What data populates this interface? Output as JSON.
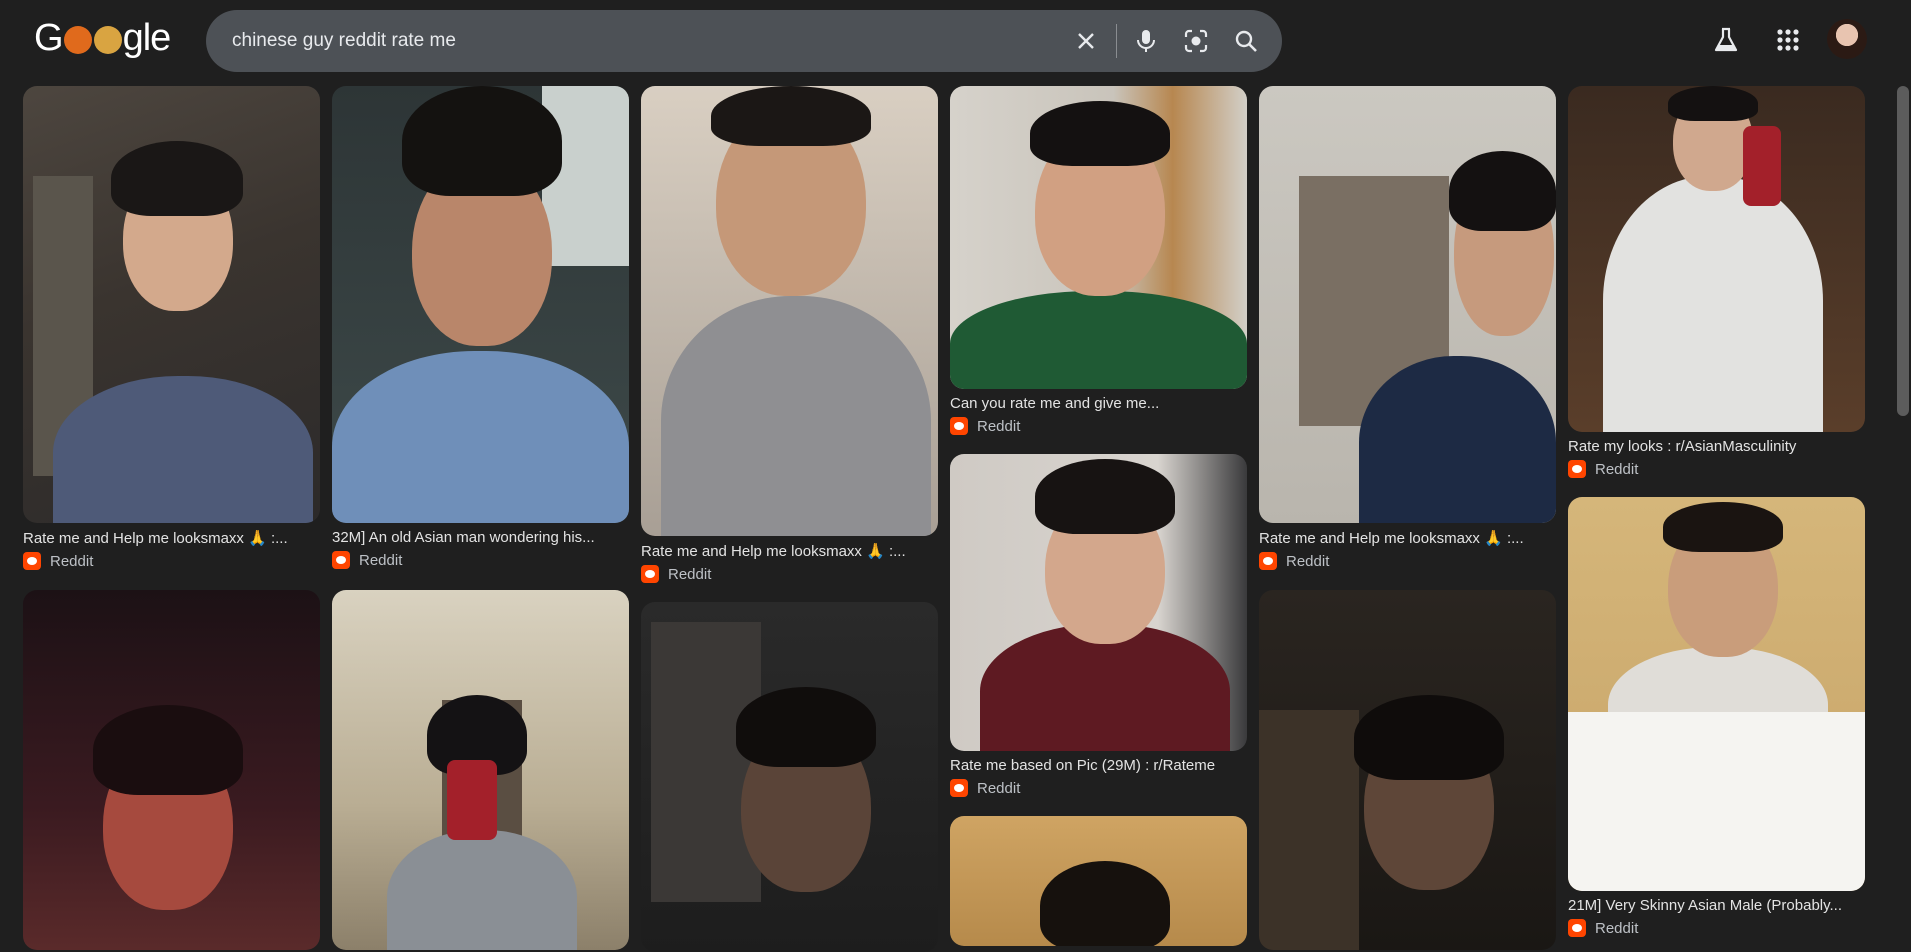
{
  "header": {
    "logo_text_1": "G",
    "logo_text_2": "gle",
    "search_query": "chinese guy reddit rate me"
  },
  "icons": {
    "clear": "close-icon",
    "voice": "microphone-icon",
    "lens": "google-lens-icon",
    "search": "search-icon",
    "labs": "flask-icon",
    "apps": "apps-grid-icon",
    "account": "avatar"
  },
  "results": [
    {
      "caption": "Rate me and Help me looksmaxx 🙏 :...",
      "source": "Reddit"
    },
    {
      "caption": "32M] An old Asian man wondering his...",
      "source": "Reddit"
    },
    {
      "caption": "Rate me and Help me looksmaxx 🙏 :...",
      "source": "Reddit"
    },
    {
      "caption": "Can you rate me and give me...",
      "source": "Reddit"
    },
    {
      "caption": "Rate me and Help me looksmaxx 🙏 :...",
      "source": "Reddit"
    },
    {
      "caption": "Rate my looks : r/AsianMasculinity",
      "source": "Reddit"
    },
    {
      "caption": "Rate me based on Pic (29M) : r/Rateme",
      "source": "Reddit"
    },
    {
      "caption": "21M] Very Skinny Asian Male (Probably...",
      "source": "Reddit"
    }
  ],
  "colors": {
    "background": "#1f1f1f",
    "search_bg": "#4d5156",
    "reddit": "#ff4500"
  }
}
